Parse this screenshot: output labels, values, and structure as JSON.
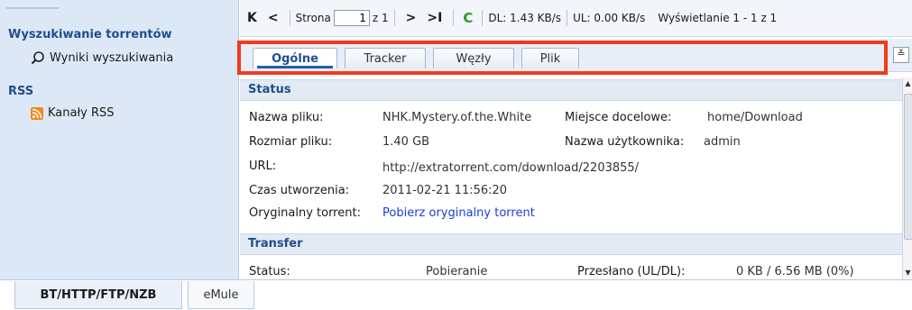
{
  "sidebar": {
    "search_heading": "Wyszukiwanie torrentów",
    "search_item": "Wyniki wyszukiwania",
    "rss_heading": "RSS",
    "rss_item": "Kanały RSS"
  },
  "toolbar": {
    "first_icon": "K",
    "prev_icon": "<",
    "page_label": "Strona",
    "page_value": "1",
    "page_of": "z 1",
    "next_icon": ">",
    "last_icon": ">I",
    "refresh_icon": "C",
    "dl_speed": "DL: 1.43 KB/s",
    "ul_speed": "UL: 0.00 KB/s",
    "display_range": "Wyświetlanie 1 - 1 z 1"
  },
  "tabs": [
    {
      "label": "Ogólne",
      "active": true
    },
    {
      "label": "Tracker",
      "active": false
    },
    {
      "label": "Węzły",
      "active": false
    },
    {
      "label": "Plik",
      "active": false
    }
  ],
  "collapse_icon": "≚",
  "status_section": {
    "title": "Status",
    "file_name_label": "Nazwa pliku:",
    "file_name_value": "NHK.Mystery.of.the.White",
    "destination_label": "Miejsce docelowe:",
    "destination_value": "home/Download",
    "size_label": "Rozmiar pliku:",
    "size_value": "1.40 GB",
    "username_label": "Nazwa użytkownika:",
    "username_value": "admin",
    "url_label": "URL:",
    "url_value": "http://extratorrent.com/download/2203855/",
    "created_label": "Czas utworzenia:",
    "created_value": "2011-02-21 11:56:20",
    "original_label": "Oryginalny torrent:",
    "original_link": "Pobierz oryginalny torrent"
  },
  "transfer_section": {
    "title": "Transfer",
    "status_label": "Status:",
    "status_value": "Pobieranie",
    "transferred_label": "Przesłano (UL/DL):",
    "transferred_value": "0 KB / 6.56 MB (0%)"
  },
  "bottom_tabs": [
    {
      "label": "BT/HTTP/FTP/NZB",
      "active": true
    },
    {
      "label": "eMule",
      "active": false
    }
  ],
  "colors": {
    "highlight": "#f03a1f",
    "heading": "#1f4e8f",
    "link": "#1a3fd6",
    "refresh": "#2a9b2a",
    "rss": "#f08a1c"
  }
}
